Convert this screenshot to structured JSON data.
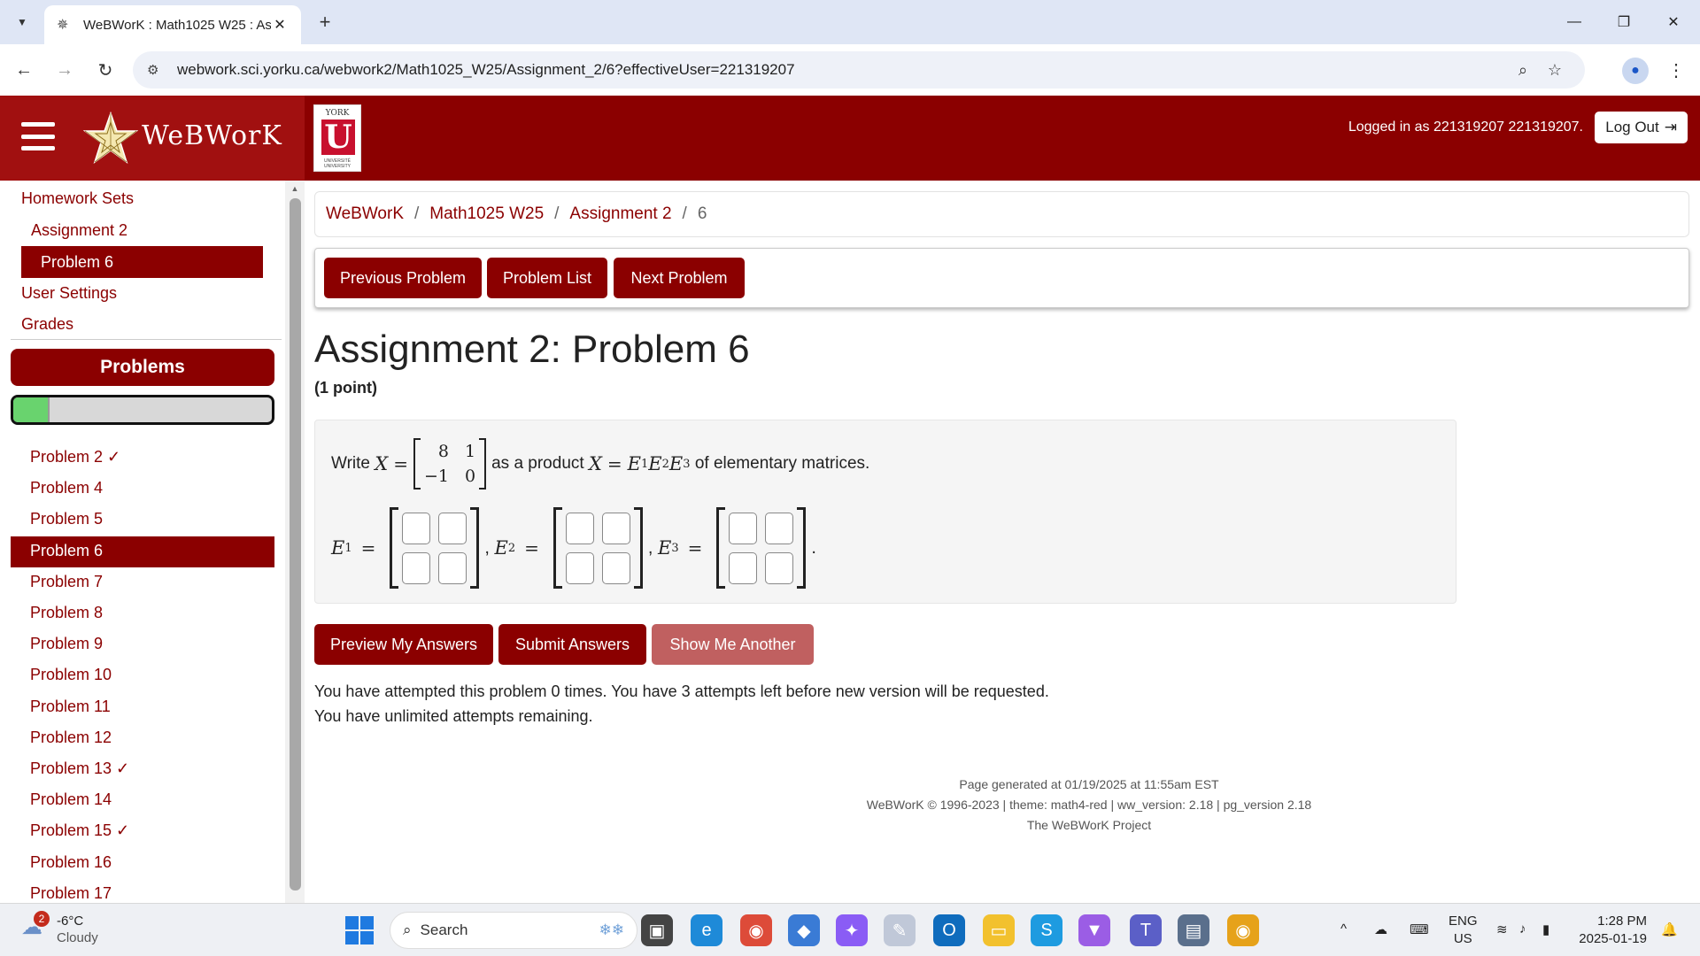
{
  "browser": {
    "tab_title": "WeBWorK : Math1025 W25 : As",
    "url": "webwork.sci.yorku.ca/webwork2/Math1025_W25/Assignment_2/6?effectiveUser=221319207"
  },
  "header": {
    "logo_text": "WeBWorK",
    "york_top": "YORK",
    "york_letter": "U",
    "york_bottom": "UNIVERSITÉ UNIVERSITY",
    "logged_in": "Logged in as 221319207 221319207.",
    "logout_label": "Log Out"
  },
  "sidebar": {
    "homework_sets": "Homework Sets",
    "assignment": "Assignment 2",
    "current_problem": "Problem 6",
    "user_settings": "User Settings",
    "grades": "Grades",
    "problems_heading": "Problems",
    "progress_fraction": 0.14,
    "problems": [
      {
        "label": "Problem 2 ✓",
        "active": false
      },
      {
        "label": "Problem 4",
        "active": false
      },
      {
        "label": "Problem 5",
        "active": false
      },
      {
        "label": "Problem 6",
        "active": true
      },
      {
        "label": "Problem 7",
        "active": false
      },
      {
        "label": "Problem 8",
        "active": false
      },
      {
        "label": "Problem 9",
        "active": false
      },
      {
        "label": "Problem 10",
        "active": false
      },
      {
        "label": "Problem 11",
        "active": false
      },
      {
        "label": "Problem 12",
        "active": false
      },
      {
        "label": "Problem 13 ✓",
        "active": false
      },
      {
        "label": "Problem 14",
        "active": false
      },
      {
        "label": "Problem 15 ✓",
        "active": false
      },
      {
        "label": "Problem 16",
        "active": false
      },
      {
        "label": "Problem 17",
        "active": false
      }
    ]
  },
  "breadcrumb": {
    "root": "WeBWorK",
    "course": "Math1025 W25",
    "set": "Assignment 2",
    "problem": "6"
  },
  "nav": {
    "previous": "Previous Problem",
    "list": "Problem List",
    "next": "Next Problem"
  },
  "problem": {
    "title": "Assignment 2: Problem 6",
    "points": "(1 point)",
    "write": "Write",
    "x_var": "X",
    "equals": "=",
    "matrix": [
      "8",
      "1",
      "−1",
      "0"
    ],
    "as_product": "as a product",
    "product_lhs": "X",
    "e1": "E",
    "e2": "E",
    "e3": "E",
    "sub1": "1",
    "sub2": "2",
    "sub3": "3",
    "of_elementary": "of elementary matrices.",
    "comma": ",",
    "period": "."
  },
  "actions": {
    "preview": "Preview My Answers",
    "submit": "Submit Answers",
    "show_another": "Show Me Another"
  },
  "attempts": {
    "line1": "You have attempted this problem 0 times. You have 3 attempts left before new version will be requested.",
    "line2": "You have unlimited attempts remaining."
  },
  "footer": {
    "generated": "Page generated at 01/19/2025 at 11:55am EST",
    "version": "WeBWorK © 1996-2023 | theme: math4-red | ww_version: 2.18 | pg_version 2.18",
    "project": "The WeBWorK Project"
  },
  "taskbar": {
    "weather_badge": "2",
    "temperature": "-6°C",
    "condition": "Cloudy",
    "search_placeholder": "Search",
    "lang": "ENG",
    "region": "US",
    "time": "1:28 PM",
    "date": "2025-01-19"
  },
  "colors": {
    "brand_red": "#8b0000",
    "show_another": "#c06060"
  }
}
